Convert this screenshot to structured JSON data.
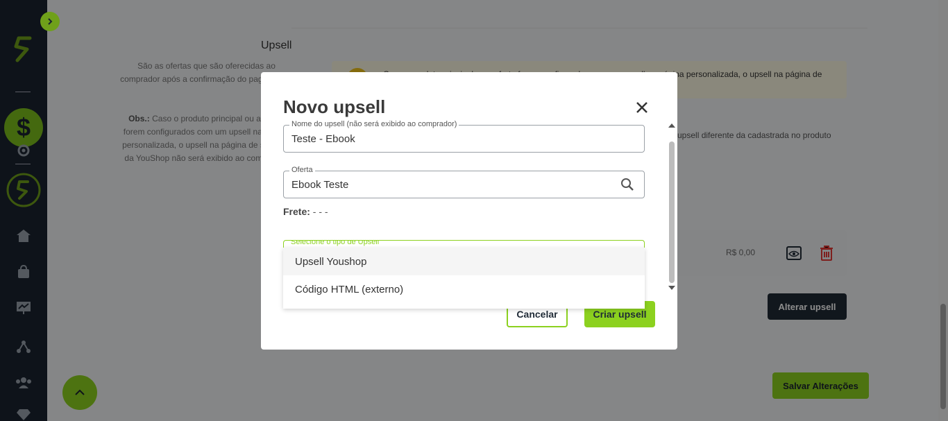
{
  "page": {
    "upsell_title": "Upsell",
    "upsell_desc": "São as ofertas que são oferecidas ao comprador após a confirmação do pagamento.",
    "obs_label": "Obs.:",
    "obs_text": "Caso o produto principal ou a oferta forem configurados com um upsell na página personalizada, o upsell na página de sucesso da YouShop não será exibido ao comprador.",
    "warning_text": "Caso o produto principal ou a oferta forem configurados com um upsell na página personalizada, o upsell na página de sucesso não será exibido.",
    "right_text": "upsell diferente da cadastrada no produto",
    "row_price": "R$ 0,00",
    "alter_upsell_label": "Alterar upsell",
    "save_label": "Salvar Alterações"
  },
  "modal": {
    "title": "Novo upsell",
    "name_label": "Nome do upsell (não será exibido ao comprador)",
    "name_value": "Teste - Ebook",
    "offer_label": "Oferta",
    "offer_value": "Ebook Teste",
    "frete_label": "Frete:",
    "frete_value": "- - -",
    "type_label": "Selecione o tipo de Upsell",
    "options": [
      "Upsell Youshop",
      "Código HTML (externo)"
    ],
    "cancel_label": "Cancelar",
    "create_label": "Criar upsell"
  },
  "colors": {
    "accent": "#8cd11f",
    "sidebar": "#1b2430",
    "dark_button": "#1f2a36"
  }
}
